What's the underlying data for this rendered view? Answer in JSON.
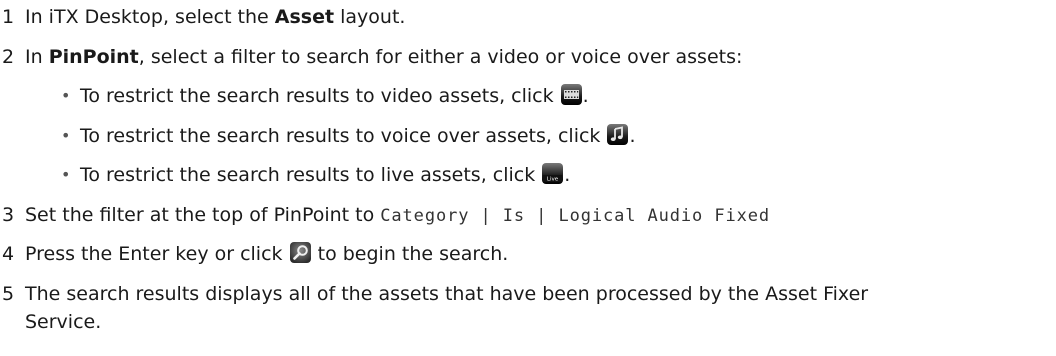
{
  "steps": [
    {
      "num": "1",
      "pre": "In iTX Desktop, select the ",
      "bold": "Asset",
      "post": " layout."
    },
    {
      "num": "2",
      "pre": "In ",
      "bold": "PinPoint",
      "post": ", select a filter to search for either a video or voice over assets:",
      "bullets": [
        {
          "text": "To restrict the search results to video assets, click ",
          "icon": "video-filter-icon",
          "end": "."
        },
        {
          "text": "To restrict the search results to voice over assets, click ",
          "icon": "voice-over-filter-icon",
          "end": "."
        },
        {
          "text": "To restrict the search results to live assets, click ",
          "icon": "live-filter-icon",
          "end": "."
        }
      ]
    },
    {
      "num": "3",
      "pre": "Set the filter at the top of PinPoint to ",
      "code": "Category | Is | Logical Audio Fixed"
    },
    {
      "num": "4",
      "pre": "Press the Enter key or click ",
      "icon": "search-icon",
      "post": " to begin the search."
    },
    {
      "num": "5",
      "line1": "The search results displays all of the assets that have been processed by the Asset Fixer",
      "line2": "Service."
    }
  ],
  "icons": {
    "live_label": "Live"
  }
}
